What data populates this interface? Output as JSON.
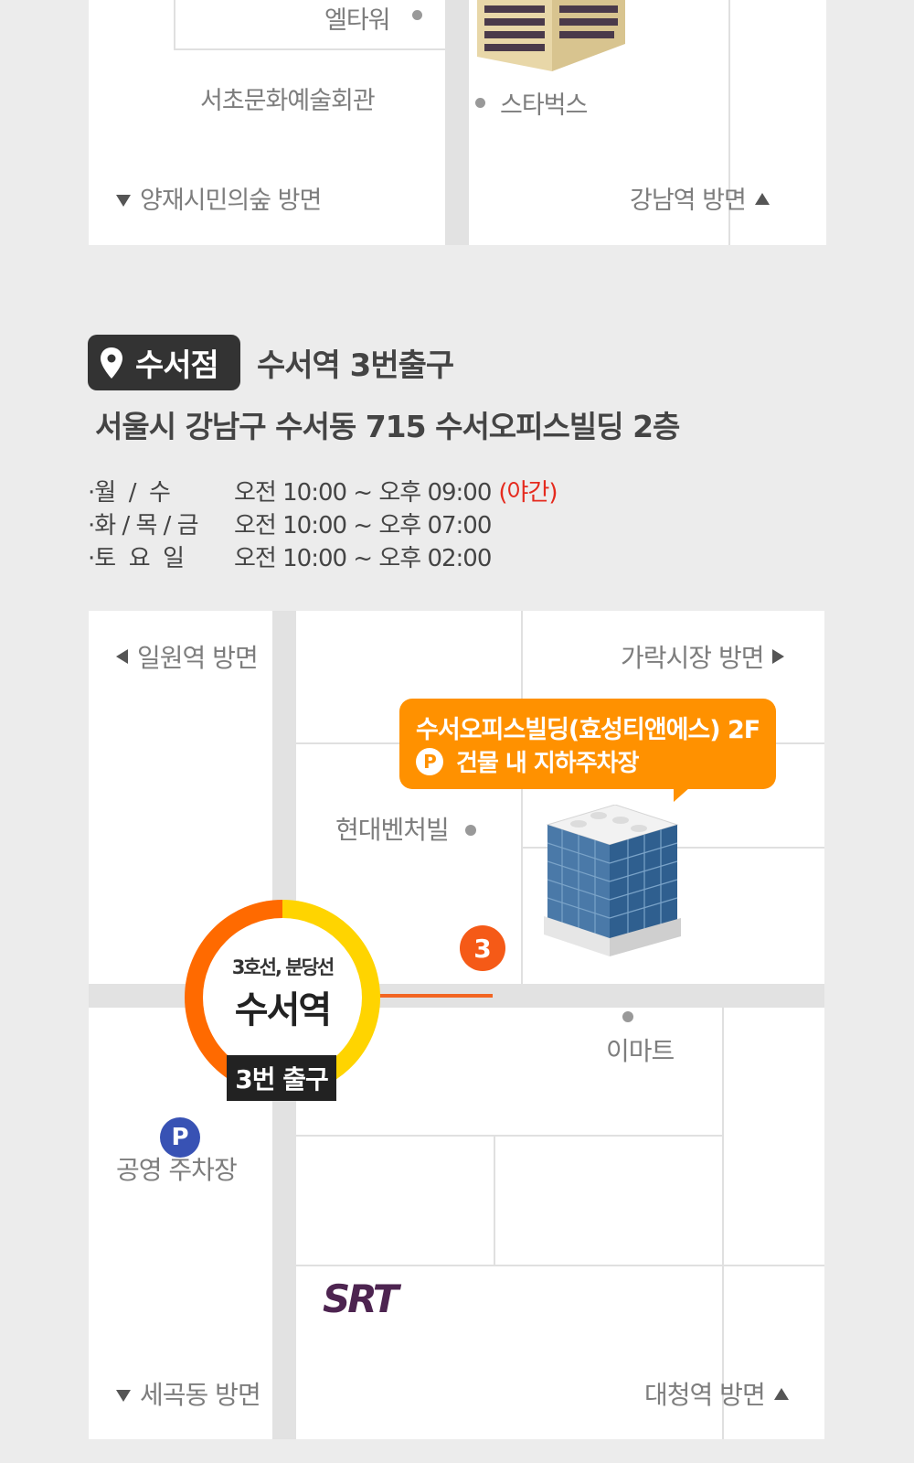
{
  "top_map": {
    "elletower": "엘타워",
    "seocho_arts": "서초문화예술회관",
    "starbucks": "스타벅스",
    "dir_left": "양재시민의숲 방면",
    "dir_right": "강남역 방면"
  },
  "branch": {
    "name": "수서점",
    "subtitle": "수서역 3번출구",
    "address": "서울시 강남구 수서동 715 수서오피스빌딩 2층"
  },
  "hours": [
    {
      "day": "·월  /  수",
      "time": "오전 10:00 ~ 오후 09:00",
      "note": "(야간)"
    },
    {
      "day": "·화 / 목 / 금",
      "time": "오전 10:00 ~ 오후 07:00",
      "note": ""
    },
    {
      "day": "·토  요  일",
      "time": "오전 10:00 ~ 오후 02:00",
      "note": ""
    }
  ],
  "map": {
    "dir_top_left": "일원역 방면",
    "dir_top_right": "가락시장 방면",
    "dir_bottom_left": "세곡동 방면",
    "dir_bottom_right": "대청역 방면",
    "bubble_line1": "수서오피스빌딩(효성티앤에스) 2F",
    "bubble_parking_icon": "P",
    "bubble_line2": "건물 내 지하주차장",
    "hyundai": "현대벤처빌",
    "emart": "이마트",
    "exit_number": "3",
    "station_lines": "3호선, 분당선",
    "station_name": "수서역",
    "exit_tag": "3번 출구",
    "parking_icon": "P",
    "parking_label": "공영 주차장",
    "srt_logo": "SRT"
  },
  "colors": {
    "orange": "#ff9100",
    "exit_orange": "#f55a17",
    "line3": "#ff6a00",
    "bundang": "#ffd400",
    "parking_blue": "#3852b4",
    "night_red": "#e52a1e",
    "srt_purple": "#4d2450"
  }
}
